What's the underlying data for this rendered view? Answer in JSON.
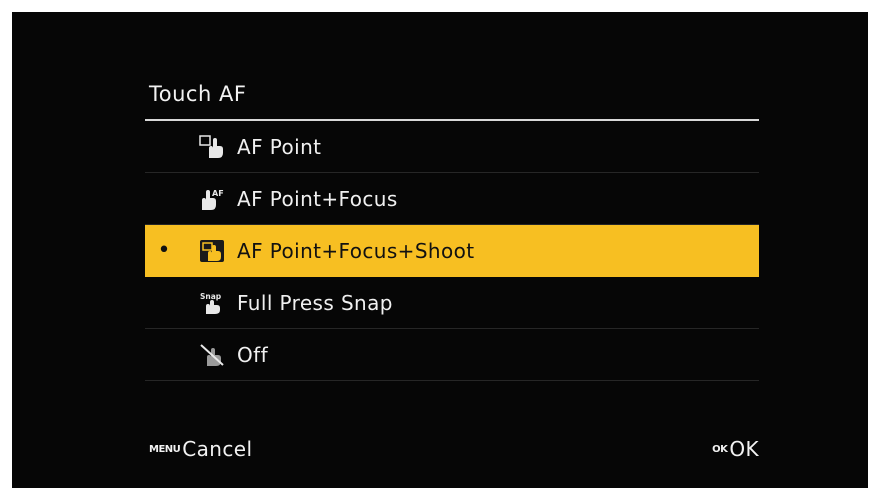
{
  "menu": {
    "title": "Touch AF",
    "items": [
      {
        "label": "AF Point",
        "icon": "touch-af-point-icon",
        "selected": false
      },
      {
        "label": "AF Point+Focus",
        "icon": "touch-af-focus-icon",
        "selected": false
      },
      {
        "label": "AF Point+Focus+Shoot",
        "icon": "touch-af-shoot-icon",
        "selected": true,
        "marker": "•"
      },
      {
        "label": "Full Press Snap",
        "icon": "touch-snap-icon",
        "selected": false
      },
      {
        "label": "Off",
        "icon": "touch-off-icon",
        "selected": false
      }
    ]
  },
  "footer": {
    "cancel_key": "MENU",
    "cancel_label": "Cancel",
    "ok_key": "OK",
    "ok_label": "OK"
  },
  "colors": {
    "background": "#060606",
    "highlight": "#f7bf22",
    "text": "#f0f0f0"
  }
}
